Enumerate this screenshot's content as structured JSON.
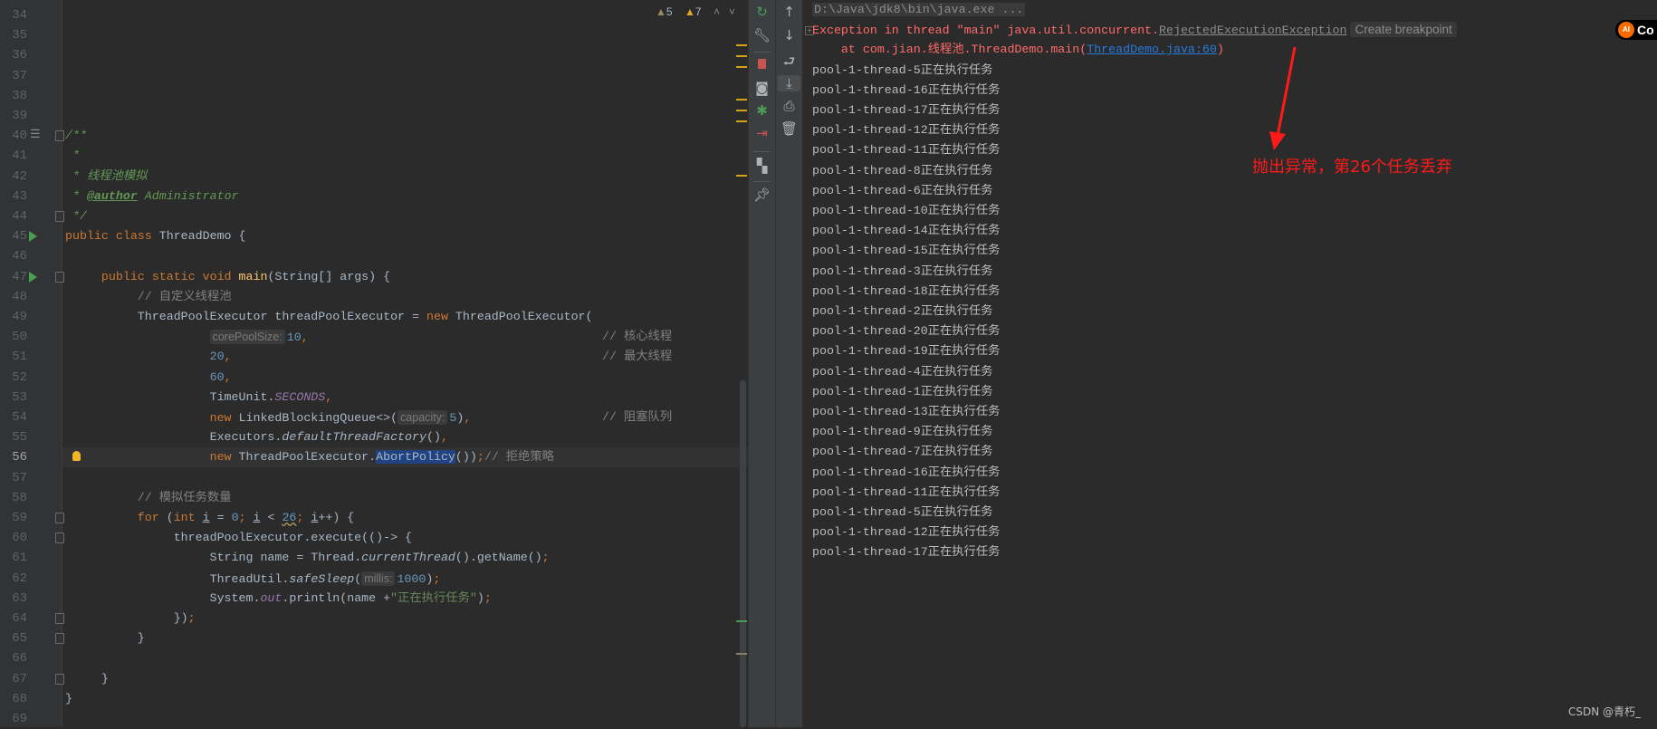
{
  "editor": {
    "warnings": {
      "weak_count": "5",
      "warn_count": "7"
    },
    "first_line": 34,
    "current_line": 56,
    "lines": [
      {
        "n": "34",
        "seg": []
      },
      {
        "n": "35",
        "seg": []
      },
      {
        "n": "36",
        "seg": []
      },
      {
        "n": "37",
        "seg": []
      },
      {
        "n": "38",
        "seg": []
      },
      {
        "n": "39",
        "seg": []
      },
      {
        "n": "40",
        "seg": [
          [
            "/**",
            "d"
          ]
        ]
      },
      {
        "n": "41",
        "seg": [
          [
            " *",
            "d"
          ]
        ]
      },
      {
        "n": "42",
        "seg": [
          [
            " * 线程池模拟",
            "d"
          ]
        ]
      },
      {
        "n": "43",
        "seg": [
          [
            " * ",
            "d"
          ],
          [
            "@author",
            "dt"
          ],
          [
            " Administrator",
            "d"
          ]
        ]
      },
      {
        "n": "44",
        "seg": [
          [
            " */",
            "d"
          ]
        ]
      },
      {
        "n": "45",
        "seg": [
          [
            "public class ",
            "k"
          ],
          [
            "ThreadDemo {",
            ""
          ]
        ]
      },
      {
        "n": "46",
        "seg": []
      },
      {
        "n": "47",
        "seg": [
          [
            "     public static void ",
            "k"
          ],
          [
            "main",
            "m"
          ],
          [
            "(String[] args) {",
            ""
          ]
        ]
      },
      {
        "n": "48",
        "seg": [
          [
            "          // 自定义线程池",
            "c"
          ]
        ]
      },
      {
        "n": "49",
        "seg": [
          [
            "          ThreadPoolExecutor threadPoolExecutor = ",
            ""
          ],
          [
            "new ",
            "k"
          ],
          [
            "ThreadPoolExecutor(",
            ""
          ]
        ]
      },
      {
        "n": "50",
        "seg": [
          [
            "                    ",
            ""
          ],
          [
            "corePoolSize:",
            "hint"
          ],
          [
            "10",
            "n"
          ],
          [
            ",",
            "k"
          ]
        ],
        "trail": "// 核心线程"
      },
      {
        "n": "51",
        "seg": [
          [
            "                    ",
            ""
          ],
          [
            "20",
            "n"
          ],
          [
            ",",
            "k"
          ]
        ],
        "trail": "// 最大线程"
      },
      {
        "n": "52",
        "seg": [
          [
            "                    ",
            ""
          ],
          [
            "60",
            "n"
          ],
          [
            ",",
            "k"
          ]
        ]
      },
      {
        "n": "53",
        "seg": [
          [
            "                    TimeUnit.",
            ""
          ],
          [
            "SECONDS",
            "st"
          ],
          [
            ",",
            "k"
          ]
        ]
      },
      {
        "n": "54",
        "seg": [
          [
            "                    ",
            ""
          ],
          [
            "new ",
            "k"
          ],
          [
            "LinkedBlockingQueue<>(",
            ""
          ],
          [
            "capacity:",
            "hint"
          ],
          [
            "5",
            "n"
          ],
          [
            ")",
            ""
          ],
          [
            ",",
            "k"
          ]
        ],
        "trail": "// 阻塞队列"
      },
      {
        "n": "55",
        "seg": [
          [
            "                    Executors.",
            ""
          ],
          [
            "defaultThreadFactory",
            "it"
          ],
          [
            "()",
            ""
          ],
          [
            ",",
            "k"
          ]
        ]
      },
      {
        "n": "56",
        "seg": [
          [
            "                    ",
            ""
          ],
          [
            "new ",
            "k"
          ],
          [
            "ThreadPoolExecutor.",
            ""
          ],
          [
            "AbortPolicy",
            "sel"
          ],
          [
            "())",
            ""
          ],
          [
            ";",
            "k"
          ],
          [
            "// 拒绝策略",
            "c"
          ]
        ]
      },
      {
        "n": "57",
        "seg": []
      },
      {
        "n": "58",
        "seg": [
          [
            "          // 模拟任务数量",
            "c"
          ]
        ]
      },
      {
        "n": "59",
        "seg": [
          [
            "          ",
            ""
          ],
          [
            "for ",
            "k"
          ],
          [
            "(",
            ""
          ],
          [
            "int ",
            "k"
          ],
          [
            "i",
            "u"
          ],
          [
            " = ",
            ""
          ],
          [
            "0",
            "n"
          ],
          [
            "; ",
            "k"
          ],
          [
            "i",
            "u"
          ],
          [
            " < ",
            ""
          ],
          [
            "26",
            "n wv"
          ],
          [
            "; ",
            "k"
          ],
          [
            "i",
            "u"
          ],
          [
            "++) {",
            ""
          ]
        ]
      },
      {
        "n": "60",
        "seg": [
          [
            "               threadPoolExecutor.execute(()-> {",
            ""
          ]
        ]
      },
      {
        "n": "61",
        "seg": [
          [
            "                    String name = Thread.",
            ""
          ],
          [
            "currentThread",
            "it"
          ],
          [
            "().getName()",
            ""
          ],
          [
            ";",
            "k"
          ]
        ]
      },
      {
        "n": "62",
        "seg": [
          [
            "                    ThreadUtil.",
            ""
          ],
          [
            "safeSleep",
            "it"
          ],
          [
            "(",
            ""
          ],
          [
            "millis:",
            "hint"
          ],
          [
            "1000",
            "n"
          ],
          [
            ")",
            ""
          ],
          [
            ";",
            "k"
          ]
        ]
      },
      {
        "n": "63",
        "seg": [
          [
            "                    System.",
            ""
          ],
          [
            "out",
            "st"
          ],
          [
            ".println(name +",
            ""
          ],
          [
            "\"正在执行任务\"",
            "s"
          ],
          [
            ")",
            ""
          ],
          [
            ";",
            "k"
          ]
        ]
      },
      {
        "n": "64",
        "seg": [
          [
            "               })",
            ""
          ],
          [
            ";",
            "k"
          ]
        ]
      },
      {
        "n": "65",
        "seg": [
          [
            "          }",
            ""
          ]
        ]
      },
      {
        "n": "66",
        "seg": []
      },
      {
        "n": "67",
        "seg": [
          [
            "     }",
            ""
          ]
        ]
      },
      {
        "n": "68",
        "seg": [
          [
            "}",
            ""
          ]
        ]
      },
      {
        "n": "69",
        "seg": []
      }
    ]
  },
  "console": {
    "command": "D:\\Java\\jdk8\\bin\\java.exe ...",
    "exception_prefix": "Exception in thread \"main\" java.util.concurrent.",
    "exception_class": "RejectedExecutionException",
    "create_breakpoint": "Create breakpoint",
    "ai_badge": "Co",
    "at_prefix": "    at com.jian.线程池.ThreadDemo.main(",
    "at_link": "ThreadDemo.java:60",
    "at_suffix": ")",
    "output": [
      "pool-1-thread-5正在执行任务",
      "pool-1-thread-16正在执行任务",
      "pool-1-thread-17正在执行任务",
      "pool-1-thread-12正在执行任务",
      "pool-1-thread-11正在执行任务",
      "pool-1-thread-8正在执行任务",
      "pool-1-thread-6正在执行任务",
      "pool-1-thread-10正在执行任务",
      "pool-1-thread-14正在执行任务",
      "pool-1-thread-15正在执行任务",
      "pool-1-thread-3正在执行任务",
      "pool-1-thread-18正在执行任务",
      "pool-1-thread-2正在执行任务",
      "pool-1-thread-20正在执行任务",
      "pool-1-thread-19正在执行任务",
      "pool-1-thread-4正在执行任务",
      "pool-1-thread-1正在执行任务",
      "pool-1-thread-13正在执行任务",
      "pool-1-thread-9正在执行任务",
      "pool-1-thread-7正在执行任务",
      "pool-1-thread-16正在执行任务",
      "pool-1-thread-11正在执行任务",
      "pool-1-thread-5正在执行任务",
      "pool-1-thread-12正在执行任务",
      "pool-1-thread-17正在执行任务"
    ]
  },
  "annotation": {
    "text": "抛出异常，第26个任务丢弃",
    "color": "#ff1a1a"
  },
  "watermark": "CSDN @青朽_",
  "toolbar1": [
    "rerun-icon",
    "wrench-icon",
    "stop-icon",
    "camera-icon",
    "debug-icon",
    "exit-icon",
    "layout-icon",
    "pin-icon"
  ],
  "toolbar2": [
    "arrow-up-icon",
    "arrow-down-icon",
    "soft-wrap-icon",
    "scroll-to-end-icon",
    "print-icon",
    "trash-icon"
  ],
  "colors": {
    "background": "#2b2b2b",
    "keyword": "#cc7832",
    "error": "#ff6b68",
    "link": "#287bde",
    "comment": "#808080",
    "doc": "#629755"
  }
}
